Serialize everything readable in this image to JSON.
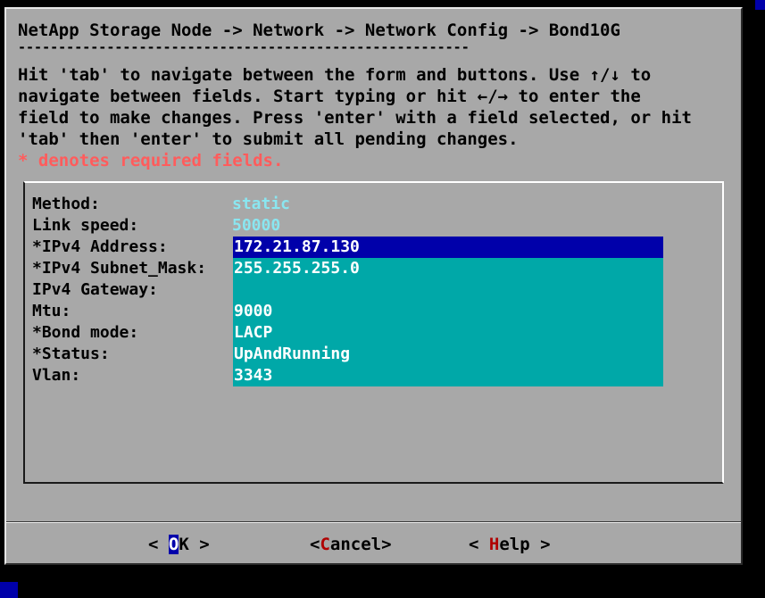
{
  "header": {
    "title": "NetApp Storage Node -> Network -> Network Config -> Bond10G",
    "separator": "--------------------------------------------------------"
  },
  "help": {
    "line1": "Hit 'tab' to navigate between the form and buttons. Use ↑/↓ to",
    "line2": "navigate between fields. Start typing or hit ←/→ to enter the",
    "line3": "field to make changes. Press 'enter' with a field selected, or hit",
    "line4": "'tab' then 'enter' to submit all pending changes.",
    "required_note": "* denotes required fields."
  },
  "form": {
    "fields": [
      {
        "label": "Method:",
        "value": "static"
      },
      {
        "label": "Link speed:",
        "value": "50000"
      },
      {
        "label": "*IPv4 Address:",
        "value": "172.21.87.130"
      },
      {
        "label": "*IPv4 Subnet_Mask:",
        "value": "255.255.255.0"
      },
      {
        "label": "IPv4 Gateway:",
        "value": ""
      },
      {
        "label": "Mtu:",
        "value": "9000"
      },
      {
        "label": "*Bond mode:",
        "value": "LACP"
      },
      {
        "label": "*Status:",
        "value": "UpAndRunning"
      },
      {
        "label": "Vlan:",
        "value": "3343"
      }
    ]
  },
  "buttons": {
    "ok": {
      "open": "< ",
      "hotkey": "O",
      "rest": "K",
      "close": " >"
    },
    "cancel": {
      "open": "<",
      "hotkey": "C",
      "rest": "ancel",
      "close": ">"
    },
    "help": {
      "open": "< ",
      "hotkey": "H",
      "rest": "elp",
      "close": " >"
    }
  },
  "colors": {
    "dialog_bg": "#a8a8a8",
    "field_bg": "#00a8a8",
    "selected_field_bg": "#0000aa",
    "readonly_value": "#8ae6f0",
    "required_note": "#ff5c5c",
    "hotkey": "#b00000"
  }
}
